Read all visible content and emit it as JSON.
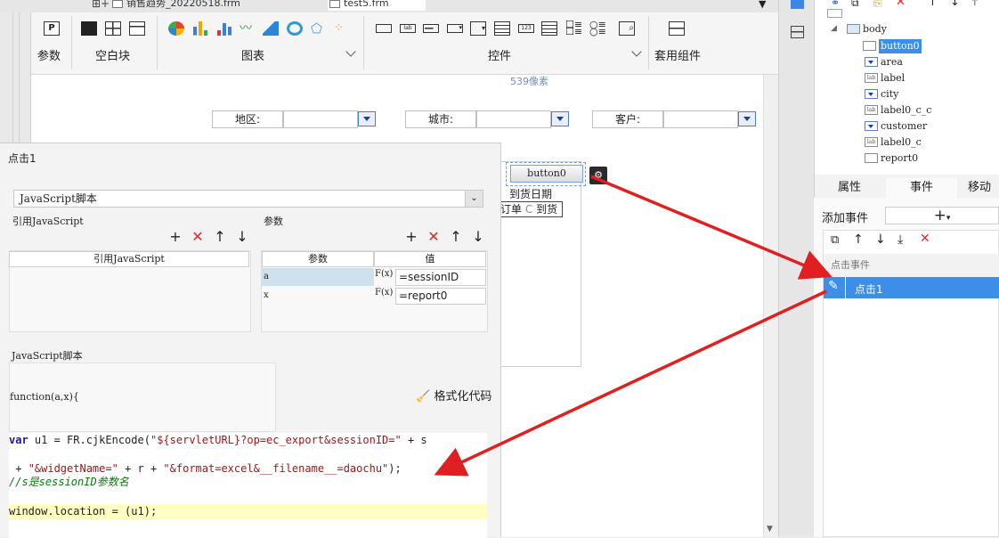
{
  "file_tabs": [
    {
      "label": "销售趋势_20220518.frm"
    },
    {
      "label": "test5.frm"
    }
  ],
  "ribbon": {
    "params_label": "参数",
    "blank_label": "空白块",
    "chart_label": "图表",
    "widget_label": "控件",
    "component_label": "套用组件"
  },
  "canvas": {
    "width_hint": "539像素",
    "region_label": "地区:",
    "city_label": "城市:",
    "customer_label": "客户:",
    "button_label": "button0",
    "report_col1": "到货日期",
    "report_col2a": "订单",
    "report_col2b": "到货"
  },
  "dialog": {
    "title": "点击1",
    "type_select": "JavaScript脚本",
    "ref_js_heading": "引用JavaScript",
    "ref_js_column": "引用JavaScript",
    "params_heading": "参数",
    "param_col_name": "参数",
    "param_col_value": "值",
    "params": [
      {
        "name": "a",
        "fx": "F(x)",
        "value": "=sessionID"
      },
      {
        "name": "x",
        "fx": "F(x)",
        "value": "=report0"
      }
    ],
    "script_heading": "JavaScript脚本",
    "function_sig": "function(a,x){",
    "format_button": "格式化代码",
    "code_lines": [
      {
        "pre": "var u1 = FR.cjkEncode(",
        "str": "\"${servletURL}?op=ec_export&sessionID=\"",
        "post": " + s"
      },
      {
        "pre": " + ",
        "str": "\"&widgetName=\"",
        "post": " + r + ",
        "str2": "\"&format=excel&__filename__=daochu\"",
        "post2": ");"
      },
      {
        "comment": "//s是sessionID参数名"
      },
      {
        "pre": "window.location = (u1);"
      }
    ]
  },
  "tree": {
    "items": [
      {
        "label": "body"
      },
      {
        "label": "button0"
      },
      {
        "label": "area"
      },
      {
        "label": "label"
      },
      {
        "label": "city"
      },
      {
        "label": "label0_c_c"
      },
      {
        "label": "customer"
      },
      {
        "label": "label0_c"
      },
      {
        "label": "report0"
      }
    ]
  },
  "props": {
    "tab_properties": "属性",
    "tab_events": "事件",
    "tab_move": "移动",
    "add_event_label": "添加事件",
    "click_event_header": "点击事件",
    "event_item": "点击1"
  },
  "colors": {
    "arrow": "#e02020",
    "selection": "#3d8ee8",
    "highlight_line": "#ffffc4",
    "keyword": "#1a1aa6",
    "string": "#a31515",
    "comment": "#0a7a0a"
  }
}
